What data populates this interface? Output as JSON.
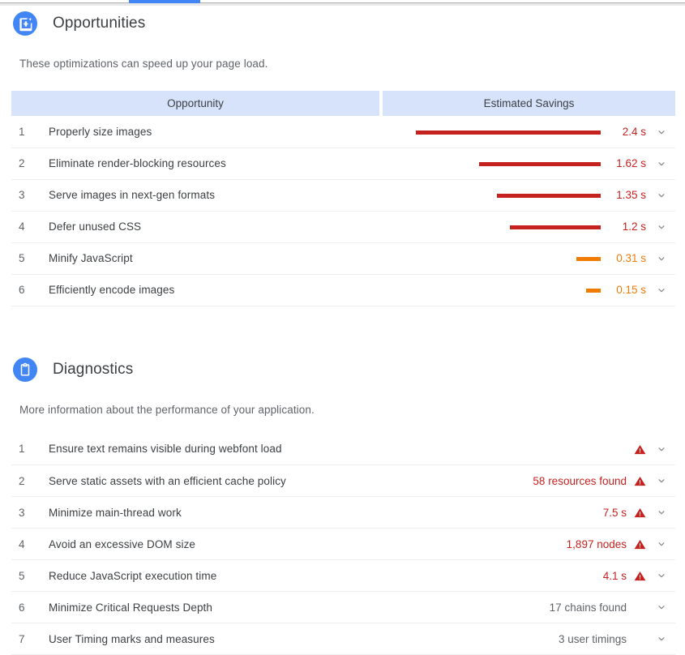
{
  "tabstrip": {
    "active_tab_indicator": "performance"
  },
  "opportunities": {
    "icon": "image-sparkle-icon",
    "title": "Opportunities",
    "description": "These optimizations can speed up your page load.",
    "columns": {
      "name": "Opportunity",
      "savings": "Estimated Savings"
    },
    "rows": [
      {
        "index": "1",
        "label": "Properly size images",
        "value": "2.4 s",
        "seconds": 2.4,
        "severity": "fail",
        "bar_pct": 100
      },
      {
        "index": "2",
        "label": "Eliminate render-blocking resources",
        "value": "1.62 s",
        "seconds": 1.62,
        "severity": "fail",
        "bar_pct": 66
      },
      {
        "index": "3",
        "label": "Serve images in next-gen formats",
        "value": "1.35 s",
        "seconds": 1.35,
        "severity": "fail",
        "bar_pct": 56
      },
      {
        "index": "4",
        "label": "Defer unused CSS",
        "value": "1.2 s",
        "seconds": 1.2,
        "severity": "fail",
        "bar_pct": 49
      },
      {
        "index": "5",
        "label": "Minify JavaScript",
        "value": "0.31 s",
        "seconds": 0.31,
        "severity": "warn",
        "bar_pct": 13
      },
      {
        "index": "6",
        "label": "Efficiently encode images",
        "value": "0.15 s",
        "seconds": 0.15,
        "severity": "warn",
        "bar_pct": 8
      }
    ]
  },
  "diagnostics": {
    "icon": "clipboard-icon",
    "title": "Diagnostics",
    "description": "More information about the performance of your application.",
    "rows": [
      {
        "index": "1",
        "label": "Ensure text remains visible during webfont load",
        "value": "",
        "severity": "fail"
      },
      {
        "index": "2",
        "label": "Serve static assets with an efficient cache policy",
        "value": "58 resources found",
        "severity": "fail"
      },
      {
        "index": "3",
        "label": "Minimize main-thread work",
        "value": "7.5 s",
        "severity": "fail"
      },
      {
        "index": "4",
        "label": "Avoid an excessive DOM size",
        "value": "1,897 nodes",
        "severity": "fail"
      },
      {
        "index": "5",
        "label": "Reduce JavaScript execution time",
        "value": "4.1 s",
        "severity": "fail"
      },
      {
        "index": "6",
        "label": "Minimize Critical Requests Depth",
        "value": "17 chains found",
        "severity": "none"
      },
      {
        "index": "7",
        "label": "User Timing marks and measures",
        "value": "3 user timings",
        "severity": "none"
      }
    ]
  },
  "colors": {
    "accent_blue": "#4285f4",
    "header_blue": "#d7e3fb",
    "fail_red": "#c5221f",
    "warn_orange": "#ef7c00",
    "text_primary": "#3c4043",
    "text_secondary": "#5f6368"
  }
}
